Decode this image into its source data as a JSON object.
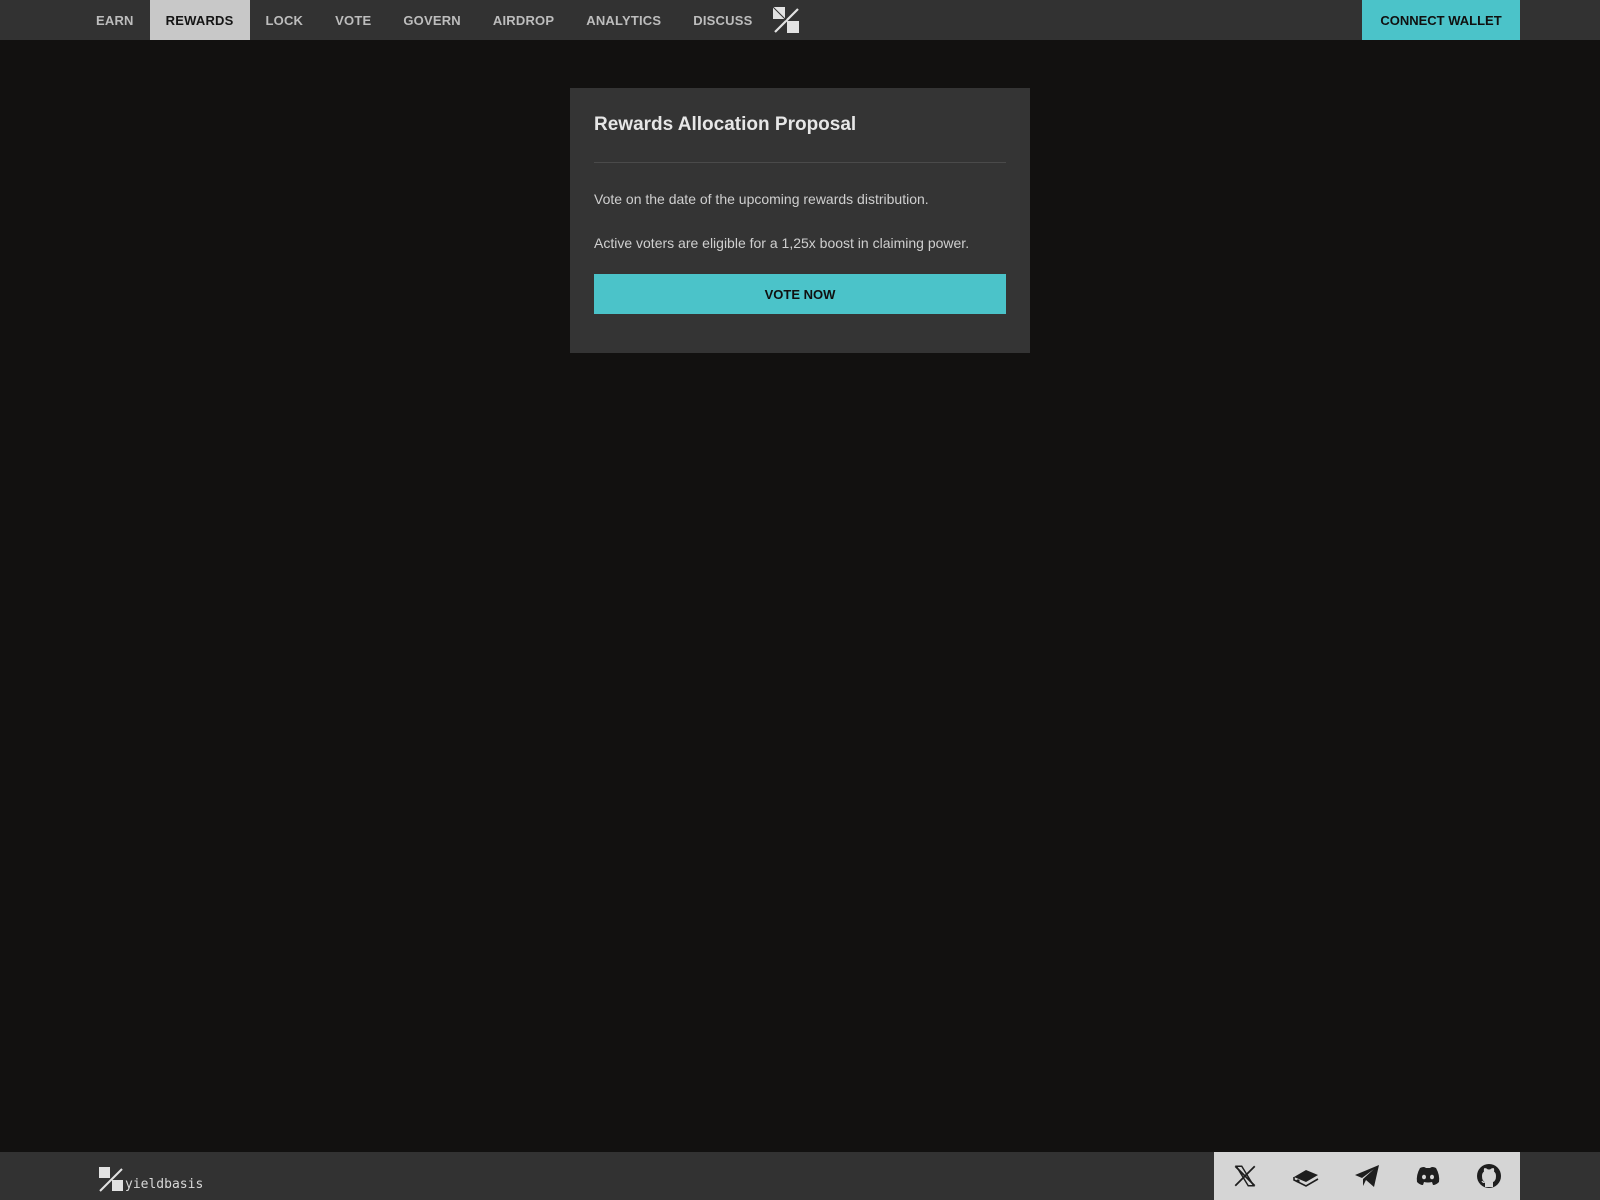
{
  "nav": {
    "items": [
      {
        "label": "EARN",
        "active": false
      },
      {
        "label": "REWARDS",
        "active": true
      },
      {
        "label": "LOCK",
        "active": false
      },
      {
        "label": "VOTE",
        "active": false
      },
      {
        "label": "GOVERN",
        "active": false
      },
      {
        "label": "AIRDROP",
        "active": false
      },
      {
        "label": "ANALYTICS",
        "active": false
      },
      {
        "label": "DISCUSS",
        "active": false
      }
    ],
    "logo_icon": "yieldbasis-logo-icon",
    "connect_label": "CONNECT WALLET"
  },
  "card": {
    "title": "Rewards Allocation Proposal",
    "paragraph1": "Vote on the date of the upcoming rewards distribution.",
    "paragraph2": "Active voters are eligible for a 1,25x boost in claiming power.",
    "button_label": "VOTE NOW"
  },
  "footer": {
    "brand": "yieldbasis",
    "social": [
      "x-icon",
      "gitbook-icon",
      "telegram-icon",
      "discord-icon",
      "github-icon"
    ]
  },
  "colors": {
    "accent": "#4bc3c9",
    "background": "#121110",
    "bar": "#323232",
    "card": "#343434"
  }
}
